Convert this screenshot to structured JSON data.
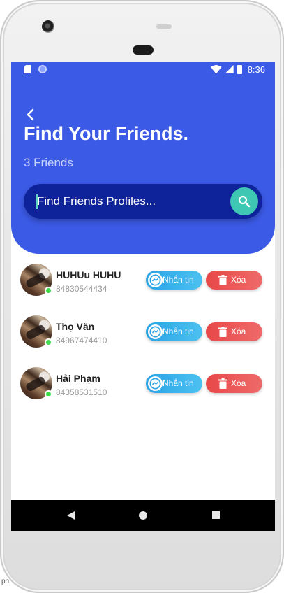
{
  "status_bar": {
    "time": "8:36"
  },
  "header": {
    "title": "Find Your Friends.",
    "subtitle": "3 Friends",
    "search_placeholder": "Find Friends Profiles..."
  },
  "friends": [
    {
      "name": "HUHUu HUHU",
      "phone": "84830544434",
      "online": true,
      "message_label": "Nhắn tin",
      "delete_label": "Xóa"
    },
    {
      "name": "Thọ Văn",
      "phone": "84967474410",
      "online": true,
      "message_label": "Nhắn tin",
      "delete_label": "Xóa"
    },
    {
      "name": "Hải Phạm",
      "phone": "84358531510",
      "online": true,
      "message_label": "Nhắn tin",
      "delete_label": "Xóa"
    }
  ],
  "colors": {
    "header_bg": "#3b5ae6",
    "search_bg": "#0e2399",
    "search_button": "#3ec8b4",
    "message_button": "#2aa3e6",
    "delete_button": "#e84848",
    "online": "#3ddc4a"
  },
  "icons": {
    "back": "chevron-left-icon",
    "search": "search-icon",
    "message": "messenger-icon",
    "delete": "trash-icon"
  },
  "edge_text": "ph"
}
